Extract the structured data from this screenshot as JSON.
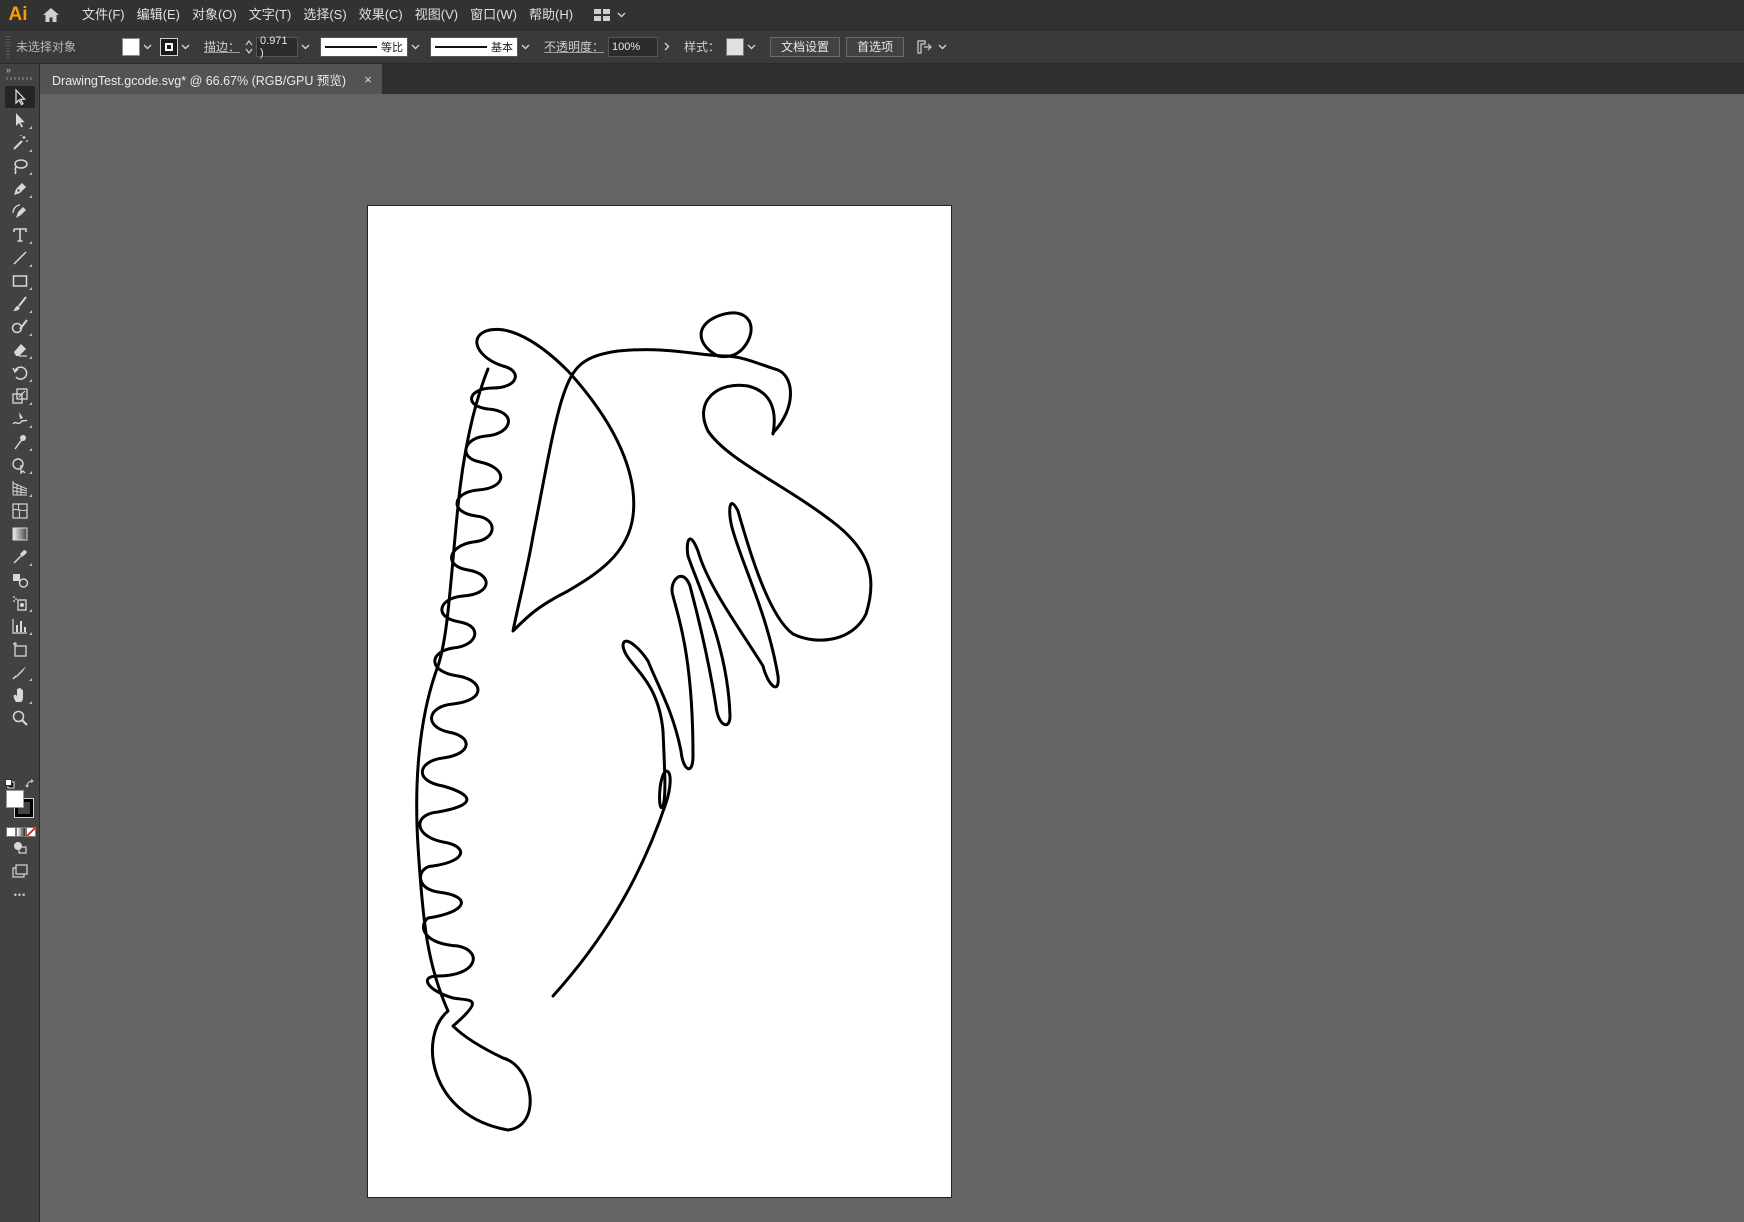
{
  "app": {
    "logo": "Ai",
    "home_icon": "home-icon"
  },
  "menu": {
    "items": [
      {
        "label": "文件(F)"
      },
      {
        "label": "编辑(E)"
      },
      {
        "label": "对象(O)"
      },
      {
        "label": "文字(T)"
      },
      {
        "label": "选择(S)"
      },
      {
        "label": "效果(C)"
      },
      {
        "label": "视图(V)"
      },
      {
        "label": "窗口(W)"
      },
      {
        "label": "帮助(H)"
      }
    ],
    "workspace_icon": "workspace-switcher-icon"
  },
  "control_bar": {
    "selection_status": "未选择对象",
    "fill_color": "#ffffff",
    "stroke_label": "描边：",
    "stroke_weight": "0.971 )",
    "stroke_profile": "等比",
    "brush_label": "基本",
    "opacity_label": "不透明度：",
    "opacity_value": "100%",
    "style_label": "样式：",
    "style_color": "#e0e0e0",
    "doc_setup_button": "文档设置",
    "preferences_button": "首选项",
    "arrange_icon": "arrange-documents-icon"
  },
  "document": {
    "tab_title": "DrawingTest.gcode.svg* @ 66.67% (RGB/GPU 预览)",
    "close_symbol": "×"
  },
  "toolbar": {
    "tools": [
      "selection-tool-icon",
      "direct-selection-tool-icon",
      "magic-wand-tool-icon",
      "lasso-tool-icon",
      "pen-tool-icon",
      "curvature-tool-icon",
      "type-tool-icon",
      "line-segment-tool-icon",
      "rectangle-tool-icon",
      "paintbrush-tool-icon",
      "shaper-tool-icon",
      "eraser-tool-icon",
      "rotate-tool-icon",
      "scale-tool-icon",
      "warp-tool-icon",
      "puppet-warp-tool-icon",
      "shape-builder-tool-icon",
      "perspective-grid-tool-icon",
      "mesh-tool-icon",
      "gradient-tool-icon",
      "eyedropper-tool-icon",
      "blend-tool-icon",
      "symbol-sprayer-tool-icon",
      "column-graph-tool-icon",
      "artboard-tool-icon",
      "slice-tool-icon",
      "hand-tool-icon",
      "zoom-tool-icon"
    ],
    "fill_color": "#ffffff",
    "stroke_color": "#000000",
    "more_symbol": "•••"
  }
}
